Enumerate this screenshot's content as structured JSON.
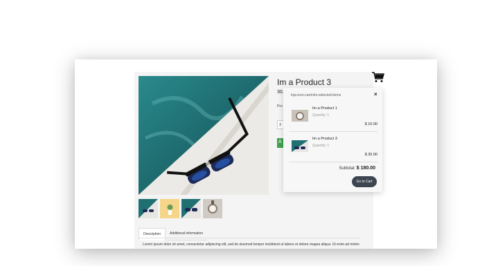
{
  "product": {
    "title": "Im a Product 3",
    "price": "30.",
    "quantity_label": "Pro",
    "quantity_value": "3",
    "add_button_peek": "A",
    "thumbnail_count": 4
  },
  "tabs": [
    {
      "label": "Description"
    },
    {
      "label": "Additional information"
    }
  ],
  "description": "Lorem ipsum dolor sit amet, consectetur adipiscing elit, sed do eiusmod tempor incididunt ut labore et dolore magna aliqua. Ut enim ad minim",
  "minicart": {
    "title": "loja-icon-carrinho-selected-items",
    "close": "×",
    "items": [
      {
        "name": "Im a Product 1",
        "quantity": "Quantity: 1",
        "price": "$ 10.00"
      },
      {
        "name": "Im a Product 3",
        "quantity": "Quantity: 1",
        "price": "$ 30.00"
      }
    ],
    "subtotal_label": "Subtotal:",
    "subtotal_value": "$ 180.00",
    "go_button": "Go to Cart"
  },
  "icons": {
    "cart": "shopping-cart-icon",
    "close": "close-icon"
  },
  "colors": {
    "pool_teal": "#1f6f73",
    "button_dark": "#3d4550",
    "add_green": "#3fa34d"
  }
}
